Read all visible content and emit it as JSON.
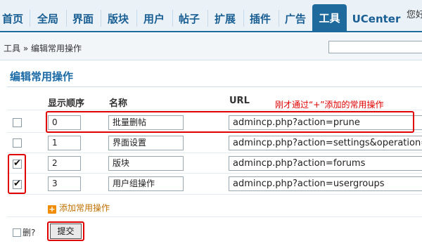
{
  "nav": {
    "items": [
      {
        "label": "首页"
      },
      {
        "label": "全局"
      },
      {
        "label": "界面"
      },
      {
        "label": "版块"
      },
      {
        "label": "用户"
      },
      {
        "label": "帖子"
      },
      {
        "label": "扩展"
      },
      {
        "label": "插件"
      },
      {
        "label": "广告"
      },
      {
        "label": "工具",
        "active": true
      },
      {
        "label": "UCenter"
      }
    ],
    "greeting": "您好"
  },
  "breadcrumb": {
    "text": "工具 » 编辑常用操作"
  },
  "page": {
    "title": "编辑常用操作"
  },
  "table": {
    "headers": {
      "order": "显示顺序",
      "name": "名称",
      "url": "URL"
    },
    "rows": [
      {
        "checked": false,
        "order": "0",
        "name": "批量删帖",
        "url": "admincp.php?action=prune"
      },
      {
        "checked": false,
        "order": "1",
        "name": "界面设置",
        "url": "admincp.php?action=settings&operation=s"
      },
      {
        "checked": true,
        "order": "2",
        "name": "版块",
        "url": "admincp.php?action=forums"
      },
      {
        "checked": true,
        "order": "3",
        "name": "用户组操作",
        "url": "admincp.php?action=usergroups"
      }
    ]
  },
  "annotation": {
    "text": "刚才通过“+”添加的常用操作"
  },
  "actions": {
    "add_label": "添加常用操作",
    "delete_label": "删?",
    "submit_label": "提交"
  },
  "colors": {
    "accent": "#1e6a9c",
    "annotation": "#e00000",
    "add_link": "#c07000"
  }
}
